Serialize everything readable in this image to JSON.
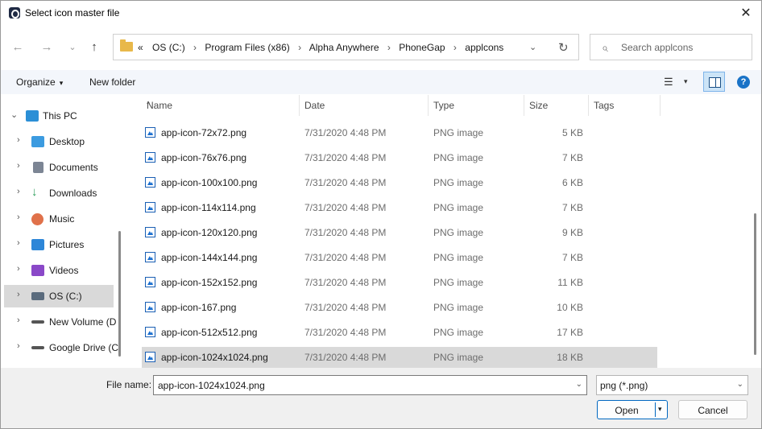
{
  "window": {
    "title": "Select icon master file",
    "close_glyph": "✕"
  },
  "nav": {
    "back_glyph": "←",
    "forward_glyph": "→",
    "recent_glyph": "⌄",
    "up_glyph": "↑"
  },
  "address": {
    "overflow": "«",
    "crumbs": [
      "OS (C:)",
      "Program Files (x86)",
      "Alpha Anywhere",
      "PhoneGap",
      "applcons"
    ],
    "separator": "›",
    "dropdown_glyph": "⌄",
    "refresh_glyph": "↻"
  },
  "search": {
    "placeholder": "Search applcons",
    "icon_glyph": "⌕"
  },
  "toolbar": {
    "organize_label": "Organize",
    "organize_caret": "▾",
    "new_folder_label": "New folder",
    "view_glyph": "☰",
    "view_caret": "▾",
    "help_glyph": "?"
  },
  "sidebar": {
    "items": [
      {
        "label": "This PC",
        "chevron": "⌄",
        "icon": "this-pc-icon",
        "color": "#2b8fd6"
      },
      {
        "label": "Desktop",
        "chevron": "›",
        "icon": "desktop-icon",
        "color": "#3c9be0"
      },
      {
        "label": "Documents",
        "chevron": "›",
        "icon": "documents-icon",
        "color": "#7c8594"
      },
      {
        "label": "Downloads",
        "chevron": "›",
        "icon": "downloads-icon",
        "color": "#2e9e5b"
      },
      {
        "label": "Music",
        "chevron": "›",
        "icon": "music-icon",
        "color": "#e0714a"
      },
      {
        "label": "Pictures",
        "chevron": "›",
        "icon": "pictures-icon",
        "color": "#2d86d8"
      },
      {
        "label": "Videos",
        "chevron": "›",
        "icon": "videos-icon",
        "color": "#8a48c8"
      },
      {
        "label": "OS (C:)",
        "chevron": "›",
        "icon": "os-drive-icon",
        "color": "#5a6b7d"
      },
      {
        "label": "New Volume (D",
        "chevron": "›",
        "icon": "drive-icon",
        "color": "#555555"
      },
      {
        "label": "Google Drive (C",
        "chevron": "›",
        "icon": "drive-icon",
        "color": "#555555"
      }
    ]
  },
  "columns": {
    "name": "Name",
    "date": "Date",
    "type": "Type",
    "size": "Size",
    "tags": "Tags",
    "sort_glyph": "^"
  },
  "files": [
    {
      "name": "app-icon-72x72.png",
      "date": "7/31/2020 4:48 PM",
      "type": "PNG image",
      "size": "5 KB"
    },
    {
      "name": "app-icon-76x76.png",
      "date": "7/31/2020 4:48 PM",
      "type": "PNG image",
      "size": "7 KB"
    },
    {
      "name": "app-icon-100x100.png",
      "date": "7/31/2020 4:48 PM",
      "type": "PNG image",
      "size": "6 KB"
    },
    {
      "name": "app-icon-114x114.png",
      "date": "7/31/2020 4:48 PM",
      "type": "PNG image",
      "size": "7 KB"
    },
    {
      "name": "app-icon-120x120.png",
      "date": "7/31/2020 4:48 PM",
      "type": "PNG image",
      "size": "9 KB"
    },
    {
      "name": "app-icon-144x144.png",
      "date": "7/31/2020 4:48 PM",
      "type": "PNG image",
      "size": "7 KB"
    },
    {
      "name": "app-icon-152x152.png",
      "date": "7/31/2020 4:48 PM",
      "type": "PNG image",
      "size": "11 KB"
    },
    {
      "name": "app-icon-167.png",
      "date": "7/31/2020 4:48 PM",
      "type": "PNG image",
      "size": "10 KB"
    },
    {
      "name": "app-icon-512x512.png",
      "date": "7/31/2020 4:48 PM",
      "type": "PNG image",
      "size": "17 KB"
    },
    {
      "name": "app-icon-1024x1024.png",
      "date": "7/31/2020 4:48 PM",
      "type": "PNG image",
      "size": "18 KB",
      "selected": true
    }
  ],
  "footer": {
    "file_name_label": "File name:",
    "file_name_value": "app-icon-1024x1024.png",
    "filter_value": "png (*.png)",
    "dropdown_glyph": "⌄",
    "open_label": "Open",
    "open_caret": "▾",
    "cancel_label": "Cancel"
  },
  "colors": {
    "selection": "#d9d9d9",
    "accent": "#0067c0",
    "toolbar_bg": "#f3f6fb"
  }
}
